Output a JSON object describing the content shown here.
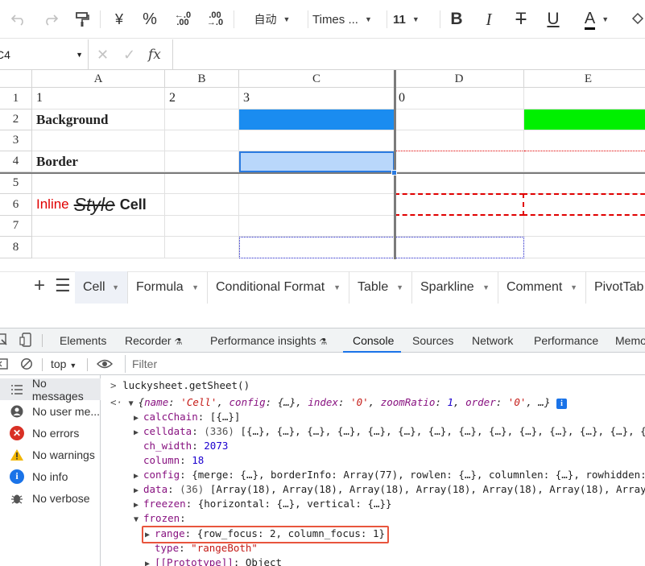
{
  "toolbar": {
    "undo_icon": "undo-icon",
    "redo_icon": "redo-icon",
    "paint_icon": "paint-format-icon",
    "currency": "¥",
    "percent": "%",
    "dec_inc_top": "←.0",
    "dec_inc_bottom": ".00",
    "dec_dec_top": ".00",
    "dec_dec_bottom": "→.0",
    "format_auto": "自动",
    "font_name": "Times ...",
    "font_size": "11",
    "bold": "B",
    "italic": "I",
    "strike": "T",
    "underline": "U",
    "font_color": "A",
    "font_color_value": "#000000"
  },
  "formula_bar": {
    "cell_ref": "C4",
    "cancel": "✕",
    "confirm": "✓",
    "fx": "fx"
  },
  "grid": {
    "columns": [
      "A",
      "B",
      "C",
      "D",
      "E"
    ],
    "rows": [
      "1",
      "2",
      "3",
      "4",
      "5",
      "6",
      "7",
      "8"
    ],
    "cells": {
      "A1": "1",
      "B1": "2",
      "C1": "3",
      "D1": "0",
      "A2": "Background",
      "A4": "Border",
      "A6_inline": "Inline",
      "A6_style": "Style",
      "A6_cell": "Cell"
    },
    "colors": {
      "c2_fill": "#1a8cf0",
      "e2_fill": "#00f000",
      "selection": "#b9d7fb",
      "dash_red": "#e00000",
      "dot_blue": "#1d20c8"
    }
  },
  "sheet_tabs": {
    "add": "+",
    "list": "☰",
    "tabs": [
      "Cell",
      "Formula",
      "Conditional Format",
      "Table",
      "Sparkline",
      "Comment",
      "PivotTab"
    ],
    "active": "Cell"
  },
  "devtools": {
    "tabs": [
      "Elements",
      "Recorder",
      "Performance insights",
      "Console",
      "Sources",
      "Network",
      "Performance",
      "Memo"
    ],
    "active_tab": "Console",
    "context": "top",
    "filter_placeholder": "Filter",
    "sidebar": [
      {
        "label": "No messages",
        "icon": "list-icon"
      },
      {
        "label": "No user me...",
        "icon": "user-icon"
      },
      {
        "label": "No errors",
        "icon": "error-icon"
      },
      {
        "label": "No warnings",
        "icon": "warning-icon"
      },
      {
        "label": "No info",
        "icon": "info-icon"
      },
      {
        "label": "No verbose",
        "icon": "bug-icon"
      }
    ]
  },
  "console": {
    "input": "luckysheet.getSheet()",
    "l1_name_val": "'Cell'",
    "l1_index_val": "'0'",
    "l1_zoom": "1",
    "l1_order_val": "'0'",
    "calcChain_val": "[{…}]",
    "celldata_count": "(336)",
    "celldata_items": "[{…}, {…}, {…}, {…}, {…}, {…}, {…}, {…}, {…}, {…}, {…}, {…}, {…}, {…}, {…}",
    "ch_width": "2073",
    "column": "18",
    "config_val": "{merge: {…}, borderInfo: Array(77), rowlen: {…}, columnlen: {…}, rowhidden:",
    "data_count": "(36)",
    "data_items": "[Array(18), Array(18), Array(18), Array(18), Array(18), Array(18), Array(",
    "freezen_val": "{horizontal: {…}, vertical: {…}}",
    "range_val": "{row_focus: 2, column_focus: 1}",
    "type_val": "\"rangeBoth\"",
    "proto_val": "Object"
  }
}
